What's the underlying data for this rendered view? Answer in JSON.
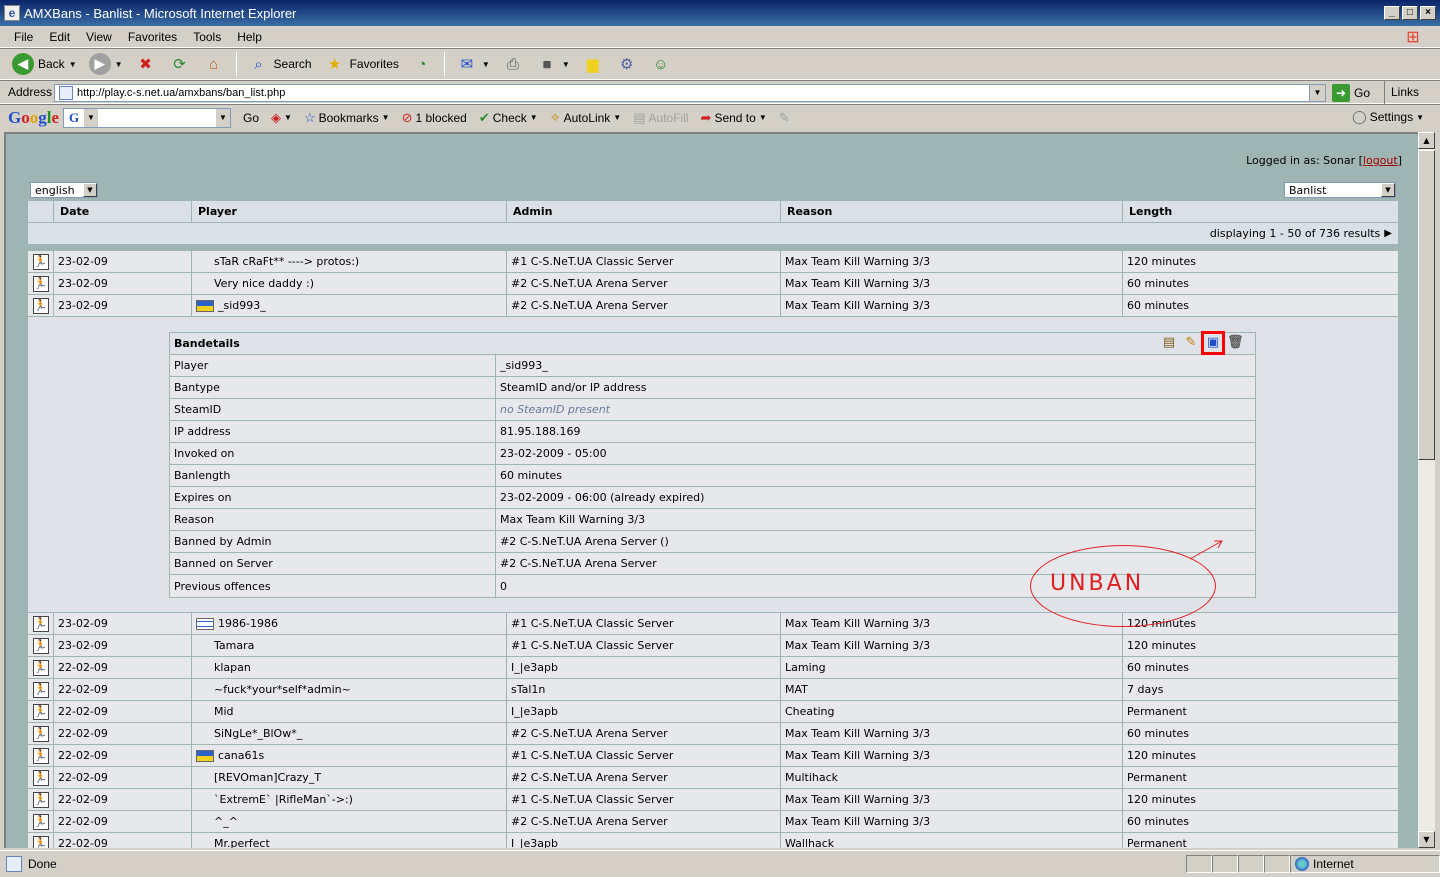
{
  "window": {
    "title": "AMXBans - Banlist - Microsoft Internet Explorer"
  },
  "menu": [
    "File",
    "Edit",
    "View",
    "Favorites",
    "Tools",
    "Help"
  ],
  "toolbar": {
    "back": "Back",
    "search": "Search",
    "favorites": "Favorites"
  },
  "address": {
    "label": "Address",
    "url": "http://play.c-s.net.ua/amxbans/ban_list.php",
    "go": "Go",
    "links": "Links"
  },
  "google": {
    "go": "Go",
    "bookmarks": "Bookmarks",
    "blocked": "1 blocked",
    "check": "Check",
    "autolink": "AutoLink",
    "autofill": "AutoFill",
    "sendto": "Send to",
    "settings": "Settings"
  },
  "page": {
    "logged_in_prefix": "Logged in as: Sonar [",
    "logout": "logout",
    "logged_in_suffix": "]",
    "language": "english",
    "view": "Banlist",
    "displaying": "displaying 1 - 50 of 736 results"
  },
  "table": {
    "headers": [
      "Date",
      "Player",
      "Admin",
      "Reason",
      "Length"
    ],
    "rows_top": [
      {
        "date": "23-02-09",
        "flag": "none",
        "player": "sTaR cRaFt** ----> protos:)",
        "admin": "#1 C-S.NeT.UA Classic Server",
        "reason": "Max Team Kill Warning 3/3",
        "length": "120 minutes"
      },
      {
        "date": "23-02-09",
        "flag": "none",
        "player": "Very nice daddy :)",
        "admin": "#2 C-S.NeT.UA Arena Server",
        "reason": "Max Team Kill Warning 3/3",
        "length": "60 minutes"
      },
      {
        "date": "23-02-09",
        "flag": "ua",
        "player": "_sid993_",
        "admin": "#2 C-S.NeT.UA Arena Server",
        "reason": "Max Team Kill Warning 3/3",
        "length": "60 minutes"
      }
    ],
    "rows_bottom": [
      {
        "date": "23-02-09",
        "flag": "il",
        "player": "1986-1986",
        "admin": "#1 C-S.NeT.UA Classic Server",
        "reason": "Max Team Kill Warning 3/3",
        "length": "120 minutes"
      },
      {
        "date": "23-02-09",
        "flag": "none",
        "player": "Tamara",
        "admin": "#1 C-S.NeT.UA Classic Server",
        "reason": "Max Team Kill Warning 3/3",
        "length": "120 minutes"
      },
      {
        "date": "22-02-09",
        "flag": "none",
        "player": "klapan",
        "admin": "I_|e3apb",
        "reason": "Laming",
        "length": "60 minutes"
      },
      {
        "date": "22-02-09",
        "flag": "none",
        "player": "~fuck*your*self*admin~",
        "admin": "sTal1n",
        "reason": "MAT",
        "length": "7 days"
      },
      {
        "date": "22-02-09",
        "flag": "none",
        "player": "Mid",
        "admin": "I_|e3apb",
        "reason": "Cheating",
        "length": "Permanent"
      },
      {
        "date": "22-02-09",
        "flag": "none",
        "player": "SiNgLe*_BlOw*_",
        "admin": "#2 C-S.NeT.UA Arena Server",
        "reason": "Max Team Kill Warning 3/3",
        "length": "60 minutes"
      },
      {
        "date": "22-02-09",
        "flag": "ua",
        "player": "cana61s",
        "admin": "#1 C-S.NeT.UA Classic Server",
        "reason": "Max Team Kill Warning 3/3",
        "length": "120 minutes"
      },
      {
        "date": "22-02-09",
        "flag": "none",
        "player": "[REVOman]Crazy_T",
        "admin": "#2 C-S.NeT.UA Arena Server",
        "reason": "Multihack",
        "length": "Permanent"
      },
      {
        "date": "22-02-09",
        "flag": "none",
        "player": "`ExtremE` |RifleMan`->:)",
        "admin": "#1 C-S.NeT.UA Classic Server",
        "reason": "Max Team Kill Warning 3/3",
        "length": "120 minutes"
      },
      {
        "date": "22-02-09",
        "flag": "none",
        "player": "^_^",
        "admin": "#2 C-S.NeT.UA Arena Server",
        "reason": "Max Team Kill Warning 3/3",
        "length": "60 minutes"
      },
      {
        "date": "22-02-09",
        "flag": "none",
        "player": "Mr.perfect",
        "admin": "I_|e3apb",
        "reason": "Wallhack",
        "length": "Permanent"
      }
    ]
  },
  "details": {
    "title": "Bandetails",
    "rows": [
      {
        "label": "Player",
        "value": "_sid993_"
      },
      {
        "label": "Bantype",
        "value": "SteamID and/or IP address"
      },
      {
        "label": "SteamID",
        "value": "no SteamID present",
        "muted": true
      },
      {
        "label": "IP address",
        "value": "81.95.188.169"
      },
      {
        "label": "Invoked on",
        "value": "23-02-2009 - 05:00"
      },
      {
        "label": "Banlength",
        "value": "60  minutes"
      },
      {
        "label": "Expires on",
        "value": "23-02-2009 - 06:00  (already expired)"
      },
      {
        "label": "Reason",
        "value": "Max Team Kill Warning 3/3"
      },
      {
        "label": "Banned by Admin",
        "value": "#2 C-S.NeT.UA Arena Server ()"
      },
      {
        "label": "Banned on Server",
        "value": "#2 C-S.NeT.UA Arena Server"
      },
      {
        "label": "Previous offences",
        "value": "0"
      }
    ]
  },
  "annotation": {
    "text": "UNBAN",
    "color": "#e02020"
  },
  "status": {
    "text": "Done",
    "zone": "Internet"
  }
}
